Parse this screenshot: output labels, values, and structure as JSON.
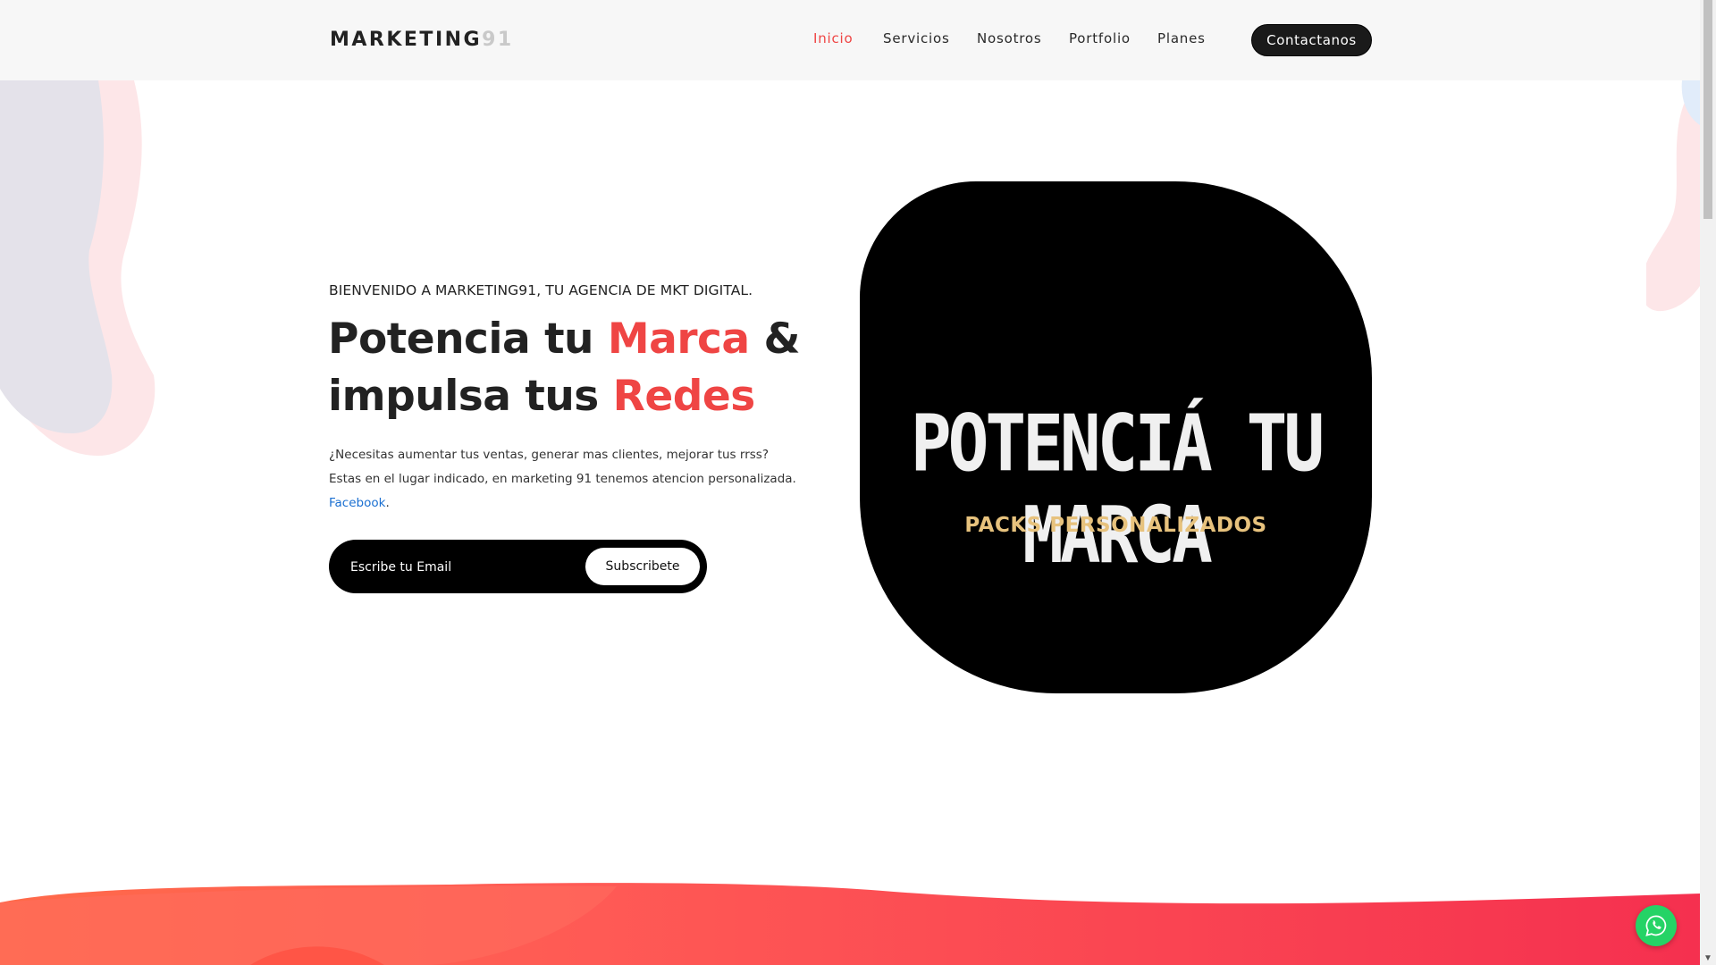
{
  "header": {
    "logo_main": "MARKETING",
    "logo_num": "91",
    "nav": [
      {
        "label": "Inicio",
        "active": true
      },
      {
        "label": "Servicios",
        "active": false
      },
      {
        "label": "Nosotros",
        "active": false
      },
      {
        "label": "Portfolio",
        "active": false
      },
      {
        "label": "Planes",
        "active": false
      }
    ],
    "contact_label": "Contactanos"
  },
  "hero": {
    "welcome": "BIENVENIDO A MARKETING91, TU AGENCIA DE MKT DIGITAL.",
    "headline": {
      "part1": "Potencia tu ",
      "highlight1": "Marca",
      "part2": " &",
      "part3": "impulsa tus ",
      "highlight2": "Redes"
    },
    "desc_line1": "¿Necesitas aumentar tus ventas, generar mas clientes, mejorar tus rrss?",
    "desc_line2": "Estas en el lugar indicado, en marketing 91 tenemos atencion personalizada.",
    "desc_link": "Facebook",
    "desc_link_suffix": ".",
    "email_placeholder": "Escribe tu Email",
    "subscribe_label": "Subscribete",
    "image_title": "POTENCIÁ TU MARCA",
    "image_subtitle": "PACKS PERSONALIZADOS"
  },
  "colors": {
    "accent": "#ef4544",
    "dark": "#1a1a1a",
    "link": "#1a6fd1",
    "whatsapp": "#25d366",
    "gold": "#e7c27d"
  },
  "icons": {
    "whatsapp": "whatsapp-icon"
  }
}
